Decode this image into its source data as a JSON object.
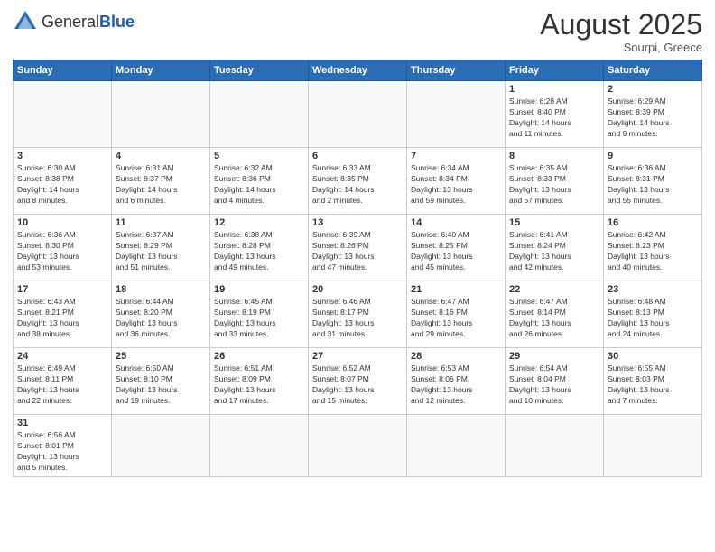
{
  "header": {
    "logo_general": "General",
    "logo_blue": "Blue",
    "month_year": "August 2025",
    "location": "Sourpi, Greece"
  },
  "weekdays": [
    "Sunday",
    "Monday",
    "Tuesday",
    "Wednesday",
    "Thursday",
    "Friday",
    "Saturday"
  ],
  "days": [
    {
      "date": "",
      "info": ""
    },
    {
      "date": "",
      "info": ""
    },
    {
      "date": "",
      "info": ""
    },
    {
      "date": "",
      "info": ""
    },
    {
      "date": "",
      "info": ""
    },
    {
      "date": "1",
      "info": "Sunrise: 6:28 AM\nSunset: 8:40 PM\nDaylight: 14 hours\nand 11 minutes."
    },
    {
      "date": "2",
      "info": "Sunrise: 6:29 AM\nSunset: 8:39 PM\nDaylight: 14 hours\nand 9 minutes."
    },
    {
      "date": "3",
      "info": "Sunrise: 6:30 AM\nSunset: 8:38 PM\nDaylight: 14 hours\nand 8 minutes."
    },
    {
      "date": "4",
      "info": "Sunrise: 6:31 AM\nSunset: 8:37 PM\nDaylight: 14 hours\nand 6 minutes."
    },
    {
      "date": "5",
      "info": "Sunrise: 6:32 AM\nSunset: 8:36 PM\nDaylight: 14 hours\nand 4 minutes."
    },
    {
      "date": "6",
      "info": "Sunrise: 6:33 AM\nSunset: 8:35 PM\nDaylight: 14 hours\nand 2 minutes."
    },
    {
      "date": "7",
      "info": "Sunrise: 6:34 AM\nSunset: 8:34 PM\nDaylight: 13 hours\nand 59 minutes."
    },
    {
      "date": "8",
      "info": "Sunrise: 6:35 AM\nSunset: 8:33 PM\nDaylight: 13 hours\nand 57 minutes."
    },
    {
      "date": "9",
      "info": "Sunrise: 6:36 AM\nSunset: 8:31 PM\nDaylight: 13 hours\nand 55 minutes."
    },
    {
      "date": "10",
      "info": "Sunrise: 6:36 AM\nSunset: 8:30 PM\nDaylight: 13 hours\nand 53 minutes."
    },
    {
      "date": "11",
      "info": "Sunrise: 6:37 AM\nSunset: 8:29 PM\nDaylight: 13 hours\nand 51 minutes."
    },
    {
      "date": "12",
      "info": "Sunrise: 6:38 AM\nSunset: 8:28 PM\nDaylight: 13 hours\nand 49 minutes."
    },
    {
      "date": "13",
      "info": "Sunrise: 6:39 AM\nSunset: 8:26 PM\nDaylight: 13 hours\nand 47 minutes."
    },
    {
      "date": "14",
      "info": "Sunrise: 6:40 AM\nSunset: 8:25 PM\nDaylight: 13 hours\nand 45 minutes."
    },
    {
      "date": "15",
      "info": "Sunrise: 6:41 AM\nSunset: 8:24 PM\nDaylight: 13 hours\nand 42 minutes."
    },
    {
      "date": "16",
      "info": "Sunrise: 6:42 AM\nSunset: 8:23 PM\nDaylight: 13 hours\nand 40 minutes."
    },
    {
      "date": "17",
      "info": "Sunrise: 6:43 AM\nSunset: 8:21 PM\nDaylight: 13 hours\nand 38 minutes."
    },
    {
      "date": "18",
      "info": "Sunrise: 6:44 AM\nSunset: 8:20 PM\nDaylight: 13 hours\nand 36 minutes."
    },
    {
      "date": "19",
      "info": "Sunrise: 6:45 AM\nSunset: 8:19 PM\nDaylight: 13 hours\nand 33 minutes."
    },
    {
      "date": "20",
      "info": "Sunrise: 6:46 AM\nSunset: 8:17 PM\nDaylight: 13 hours\nand 31 minutes."
    },
    {
      "date": "21",
      "info": "Sunrise: 6:47 AM\nSunset: 8:16 PM\nDaylight: 13 hours\nand 29 minutes."
    },
    {
      "date": "22",
      "info": "Sunrise: 6:47 AM\nSunset: 8:14 PM\nDaylight: 13 hours\nand 26 minutes."
    },
    {
      "date": "23",
      "info": "Sunrise: 6:48 AM\nSunset: 8:13 PM\nDaylight: 13 hours\nand 24 minutes."
    },
    {
      "date": "24",
      "info": "Sunrise: 6:49 AM\nSunset: 8:11 PM\nDaylight: 13 hours\nand 22 minutes."
    },
    {
      "date": "25",
      "info": "Sunrise: 6:50 AM\nSunset: 8:10 PM\nDaylight: 13 hours\nand 19 minutes."
    },
    {
      "date": "26",
      "info": "Sunrise: 6:51 AM\nSunset: 8:09 PM\nDaylight: 13 hours\nand 17 minutes."
    },
    {
      "date": "27",
      "info": "Sunrise: 6:52 AM\nSunset: 8:07 PM\nDaylight: 13 hours\nand 15 minutes."
    },
    {
      "date": "28",
      "info": "Sunrise: 6:53 AM\nSunset: 8:06 PM\nDaylight: 13 hours\nand 12 minutes."
    },
    {
      "date": "29",
      "info": "Sunrise: 6:54 AM\nSunset: 8:04 PM\nDaylight: 13 hours\nand 10 minutes."
    },
    {
      "date": "30",
      "info": "Sunrise: 6:55 AM\nSunset: 8:03 PM\nDaylight: 13 hours\nand 7 minutes."
    },
    {
      "date": "31",
      "info": "Sunrise: 6:56 AM\nSunset: 8:01 PM\nDaylight: 13 hours\nand 5 minutes."
    }
  ]
}
